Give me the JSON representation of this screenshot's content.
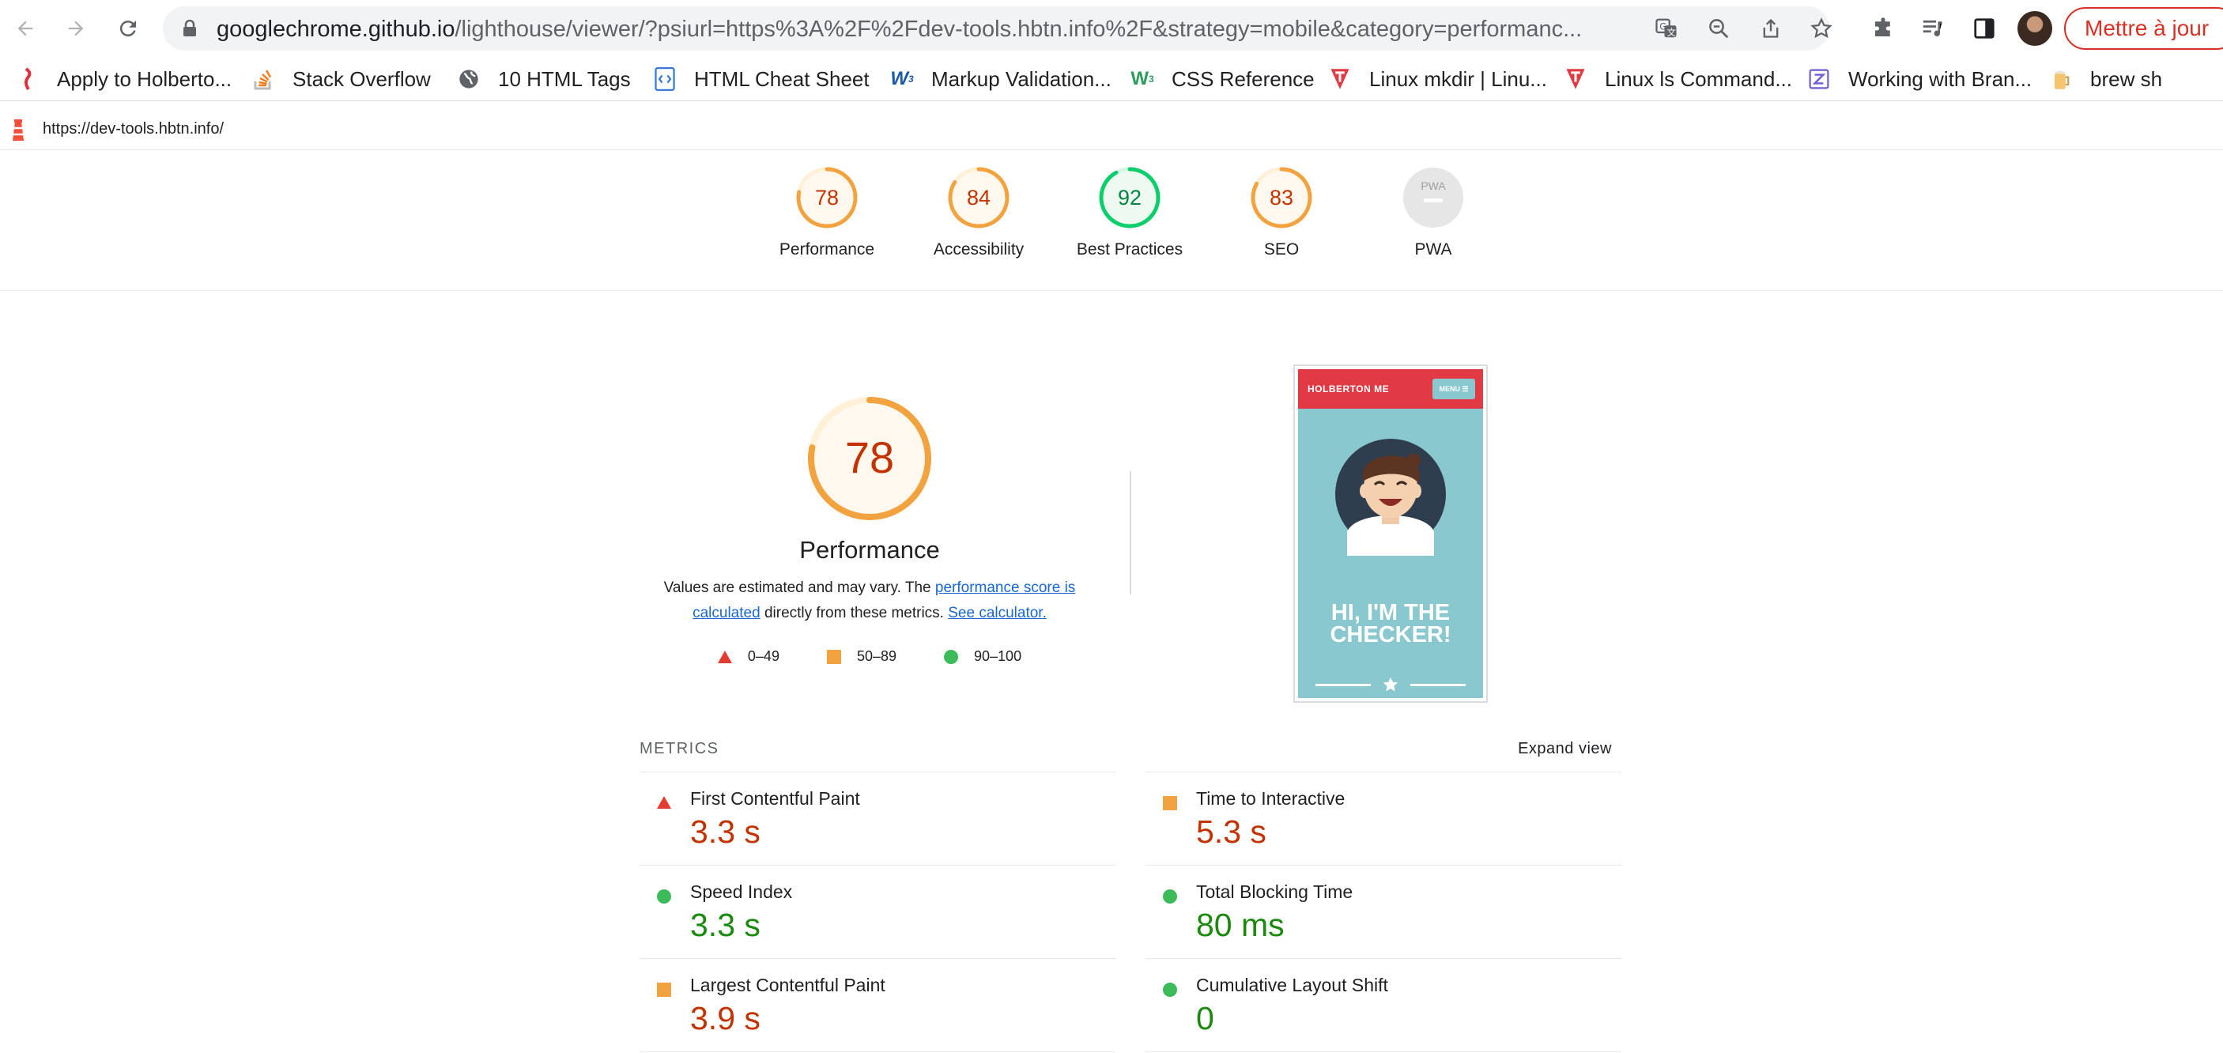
{
  "browser": {
    "url_host": "googlechrome.github.io",
    "url_rest": "/lighthouse/viewer/?psiurl=https%3A%2F%2Fdev-tools.hbtn.info%2F&strategy=mobile&category=performanc...",
    "update_label": "Mettre à jour"
  },
  "bookmarks": [
    {
      "label": "Apply to Holberto...",
      "icon": "holberton-icon"
    },
    {
      "label": "Stack Overflow",
      "icon": "stackoverflow-icon"
    },
    {
      "label": "10 HTML Tags",
      "icon": "globe-icon"
    },
    {
      "label": "HTML Cheat Sheet",
      "icon": "code-icon"
    },
    {
      "label": "Markup Validation...",
      "icon": "w3c-icon"
    },
    {
      "label": "CSS Reference",
      "icon": "css-icon"
    },
    {
      "label": "Linux mkdir | Linu...",
      "icon": "linux-icon"
    },
    {
      "label": "Linux ls Command...",
      "icon": "linux-icon"
    },
    {
      "label": "Working with Bran...",
      "icon": "zapier-icon"
    },
    {
      "label": "brew sh",
      "icon": "beer-icon"
    }
  ],
  "report": {
    "tested_url": "https://dev-tools.hbtn.info/"
  },
  "scores": [
    {
      "label": "Performance",
      "value": "78",
      "fraction": 0.78,
      "color": "#f2a23e",
      "text_color": "#c33300"
    },
    {
      "label": "Accessibility",
      "value": "84",
      "fraction": 0.84,
      "color": "#f2a23e",
      "text_color": "#c33300"
    },
    {
      "label": "Best Practices",
      "value": "92",
      "fraction": 0.92,
      "color": "#0cce6b",
      "text_color": "#018642"
    },
    {
      "label": "SEO",
      "value": "83",
      "fraction": 0.83,
      "color": "#f2a23e",
      "text_color": "#c33300"
    },
    {
      "label": "PWA",
      "value": "PWA",
      "fraction": 0,
      "color": "#e0e0e0",
      "text_color": "#9e9e9e"
    }
  ],
  "performance": {
    "score": "78",
    "fraction": 0.78,
    "title": "Performance",
    "desc_before": "Values are estimated and may vary. The ",
    "desc_link1": "performance score is calculated",
    "desc_mid": " directly from these metrics. ",
    "desc_link2": "See calculator.",
    "legend": [
      {
        "label": "0–49",
        "shape": "triangle",
        "color": "#e33c31"
      },
      {
        "label": "50–89",
        "shape": "square",
        "color": "#f2a23e"
      },
      {
        "label": "90–100",
        "shape": "circle",
        "color": "#3dbb5b"
      }
    ]
  },
  "thumbnail": {
    "brand": "HOLBERTON ME",
    "menu": "MENU ☰",
    "hero_line1": "HI, I'M THE",
    "hero_line2": "CHECKER!"
  },
  "metrics": {
    "heading": "METRICS",
    "expand_label": "Expand view",
    "items": [
      {
        "title": "First Contentful Paint",
        "value": "3.3 s",
        "rating": "fail",
        "color": "#c33300"
      },
      {
        "title": "Time to Interactive",
        "value": "5.3 s",
        "rating": "average",
        "color": "#c33300"
      },
      {
        "title": "Speed Index",
        "value": "3.3 s",
        "rating": "pass",
        "color": "#1b8a0e"
      },
      {
        "title": "Total Blocking Time",
        "value": "80 ms",
        "rating": "pass",
        "color": "#1b8a0e"
      },
      {
        "title": "Largest Contentful Paint",
        "value": "3.9 s",
        "rating": "average",
        "color": "#c33300"
      },
      {
        "title": "Cumulative Layout Shift",
        "value": "0",
        "rating": "pass",
        "color": "#1b8a0e"
      }
    ]
  }
}
